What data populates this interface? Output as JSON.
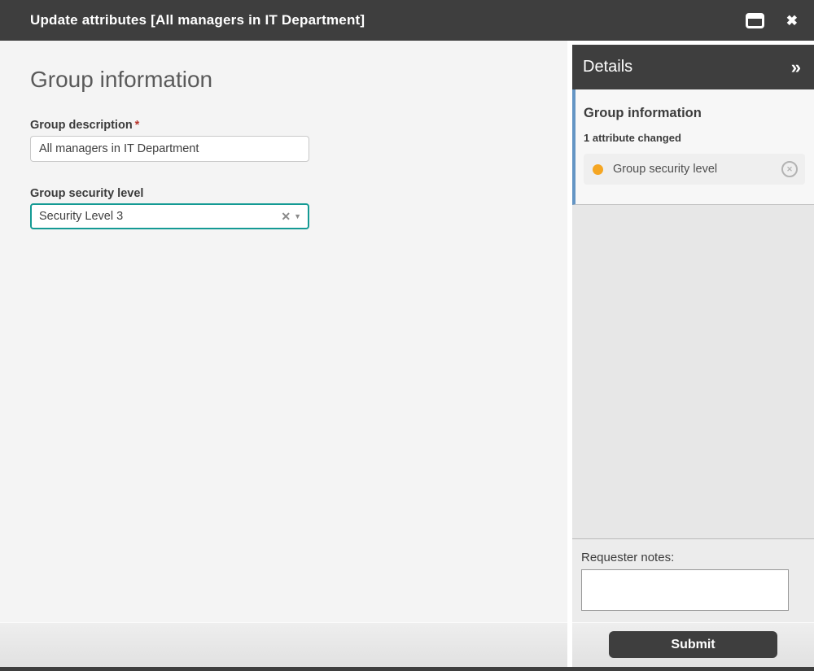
{
  "window": {
    "title": "Update attributes [All managers in IT Department]"
  },
  "icons": {
    "close": "✖",
    "collapse_right": "»",
    "clear": "✕",
    "caret_down": "▼",
    "revert": "✕"
  },
  "main": {
    "heading": "Group information",
    "required_marker": "*",
    "fields": {
      "description": {
        "label": "Group description",
        "value": "All managers in IT Department"
      },
      "security_level": {
        "label": "Group security level",
        "value": "Security Level 3"
      }
    }
  },
  "details": {
    "title": "Details",
    "group": {
      "title": "Group information",
      "summary": "1 attribute changed",
      "changed_attribute": "Group security level"
    },
    "notes_label": "Requester notes:",
    "notes_value": "",
    "submit_label": "Submit"
  },
  "colors": {
    "titlebar": "#3e3e3e",
    "accent_teal": "#149a94",
    "accent_blue": "#6495c4",
    "changed_dot": "#f5a623",
    "required": "#b8352c"
  }
}
